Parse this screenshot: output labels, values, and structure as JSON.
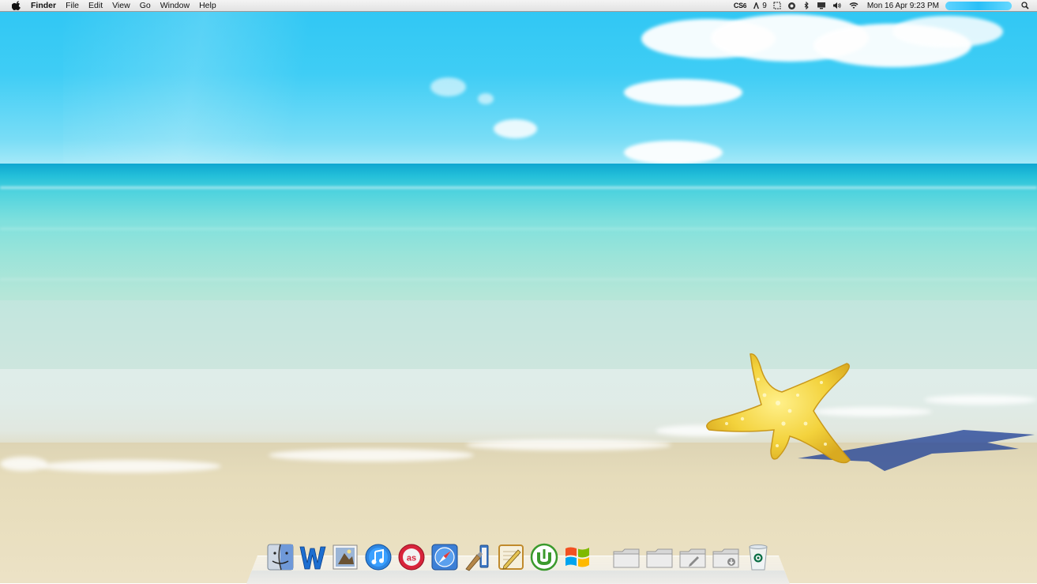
{
  "menubar": {
    "apple_icon": "apple-icon",
    "app_name": "Finder",
    "menus": [
      "File",
      "Edit",
      "View",
      "Go",
      "Window",
      "Help"
    ],
    "status": {
      "cs6_label": "CS",
      "adobe_updates_count": "9",
      "datetime": "Mon 16 Apr  9:23 PM",
      "icons": [
        "adobe-cs-icon",
        "adobe-updates-icon",
        "screenshot-icon",
        "circle-status-icon",
        "bluetooth-icon",
        "display-icon",
        "volume-icon",
        "wifi-icon",
        "spotlight-icon"
      ]
    }
  },
  "dock": {
    "apps": [
      {
        "name": "finder",
        "icon": "finder-icon"
      },
      {
        "name": "word",
        "icon": "word-icon"
      },
      {
        "name": "preview",
        "icon": "preview-icon"
      },
      {
        "name": "itunes",
        "icon": "itunes-icon"
      },
      {
        "name": "lastfm",
        "icon": "lastfm-icon"
      },
      {
        "name": "safari",
        "icon": "safari-icon"
      },
      {
        "name": "paintbrush",
        "icon": "paintbrush-icon"
      },
      {
        "name": "textedit",
        "icon": "textedit-icon"
      },
      {
        "name": "utorrent",
        "icon": "utorrent-icon"
      },
      {
        "name": "windows",
        "icon": "windows-icon"
      }
    ],
    "folders": [
      {
        "name": "folder-1",
        "icon": "folder-icon"
      },
      {
        "name": "folder-2",
        "icon": "folder-icon"
      },
      {
        "name": "documents",
        "icon": "documents-folder-icon"
      },
      {
        "name": "downloads",
        "icon": "downloads-folder-icon"
      }
    ],
    "trash": {
      "name": "trash",
      "icon": "trash-icon"
    }
  },
  "colors": {
    "sky": "#2ec6f3",
    "sea": "#23bfd9",
    "sand": "#e6dcbb",
    "starfish": "#f3d23c",
    "menubar": "#e8e8e8"
  }
}
